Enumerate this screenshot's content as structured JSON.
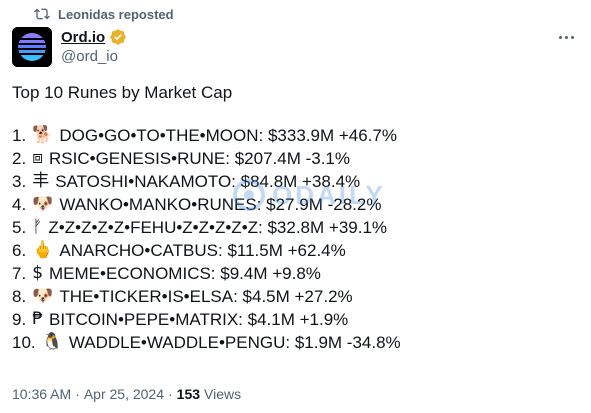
{
  "repost": {
    "text": "Leonidas reposted",
    "icon": "repost-icon"
  },
  "author": {
    "display_name": "Ord.io",
    "handle": "@ord_io",
    "verified": true,
    "verified_color": "#e8b22b",
    "avatar": "ord-io-logo"
  },
  "post": {
    "headline": "Top 10 Runes by Market Cap",
    "runes": [
      {
        "rank": "1.",
        "icon": "dog-icon",
        "glyph": "🐕",
        "text": "DOG•GO•TO•THE•MOON: $333.9M +46.7%"
      },
      {
        "rank": "2.",
        "icon": "square-icon",
        "glyph": "⧈",
        "text": "RSIC•GENESIS•RUNE: $207.4M -3.1%"
      },
      {
        "rank": "3.",
        "icon": "rune-symbol-icon",
        "glyph": "丰",
        "text": "SATOSHI•NAKAMOTO: $84.8M +38.4%"
      },
      {
        "rank": "4.",
        "icon": "dog-face-icon",
        "glyph": "🐶",
        "text": "WANKO•MANKO•RUNES: $27.9M -28.2%"
      },
      {
        "rank": "5.",
        "icon": "fehu-icon",
        "glyph": "ᚠ",
        "text": "Z•Z•Z•Z•Z•FEHU•Z•Z•Z•Z•Z: $32.8M +39.1%"
      },
      {
        "rank": "6.",
        "icon": "middle-finger-icon",
        "glyph": "🖕",
        "text": "ANARCHO•CATBUS: $11.5M +62.4%"
      },
      {
        "rank": "7.",
        "icon": "dollar-icon",
        "glyph": "$",
        "text": "MEME•ECONOMICS: $9.4M +9.8%"
      },
      {
        "rank": "8.",
        "icon": "dog-face-icon",
        "glyph": "🐶",
        "text": "THE•TICKER•IS•ELSA: $4.5M +27.2%"
      },
      {
        "rank": "9.",
        "icon": "peso-icon",
        "glyph": "₱",
        "text": "BITCOIN•PEPE•MATRIX: $4.1M +1.9%"
      },
      {
        "rank": "10.",
        "icon": "penguin-icon",
        "glyph": "🐧",
        "text": "WADDLE•WADDLE•PENGU: $1.9M -34.8%"
      }
    ]
  },
  "watermark": {
    "text": "ODAILY",
    "color": "#2f7bd8"
  },
  "meta": {
    "time": "10:36 AM",
    "separator": "·",
    "date": "Apr 25, 2024",
    "dot": "·",
    "views_count": "153",
    "views_label": "Views"
  },
  "colors": {
    "text": "#0f1419",
    "secondary": "#536471",
    "background": "#ffffff"
  }
}
